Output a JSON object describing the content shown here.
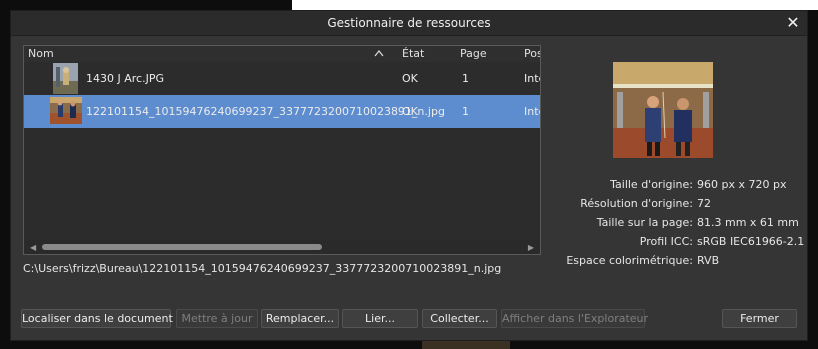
{
  "dialog": {
    "title": "Gestionnaire de ressources",
    "close_icon": "close-icon"
  },
  "list": {
    "columns": [
      "Nom",
      "État",
      "Page",
      "Pos"
    ],
    "rows": [
      {
        "name": "1430 J Arc.JPG",
        "state": "OK",
        "page": "1",
        "pos": "Inte"
      },
      {
        "name": "122101154_10159476240699237_3377723200710023891_n.jpg",
        "state": "OK",
        "page": "1",
        "pos": "Inte",
        "selected": true
      }
    ]
  },
  "path": "C:\\Users\\frizz\\Bureau\\122101154_10159476240699237_3377723200710023891_n.jpg",
  "info": [
    {
      "label": "Taille d'origine:",
      "value": "960 px x 720 px"
    },
    {
      "label": "Résolution d'origine:",
      "value": "72"
    },
    {
      "label": "Taille sur la page:",
      "value": "81.3 mm x 61 mm"
    },
    {
      "label": "Profil ICC:",
      "value": "sRGB IEC61966-2.1"
    },
    {
      "label": "Espace colorimétrique:",
      "value": "RVB"
    }
  ],
  "buttons": {
    "locate": "Localiser dans le document",
    "update": "Mettre à jour",
    "replace": "Remplacer...",
    "link": "Lier...",
    "collect": "Collecter...",
    "show_explorer": "Afficher dans l'Explorateur",
    "close": "Fermer"
  },
  "colors": {
    "selection": "#5d8ccf",
    "dialog_bg": "#353535",
    "list_bg": "#2c2c2c"
  }
}
